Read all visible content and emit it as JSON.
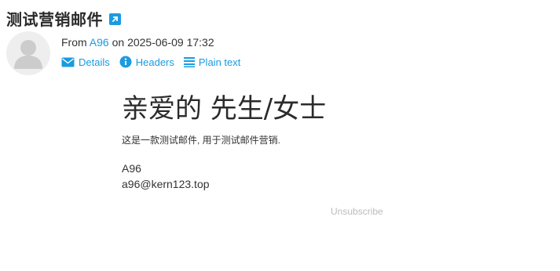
{
  "email": {
    "subject": "测试营销邮件",
    "from_prefix": "From",
    "sender_name": "A96",
    "date_prefix": "on",
    "date": "2025-06-09 17:32"
  },
  "actions": [
    {
      "label": "Details",
      "icon": "envelope-icon"
    },
    {
      "label": "Headers",
      "icon": "info-icon"
    },
    {
      "label": "Plain text",
      "icon": "lines-icon"
    }
  ],
  "content": {
    "greeting": "亲爱的 先生/女士",
    "intro": "这是一款测试邮件, 用于测试邮件营销.",
    "signature_name": "A96",
    "signature_email": "a96@kern123.top",
    "unsubscribe": "Unsubscribe"
  },
  "colors": {
    "link": "#1a9be0",
    "muted": "#bbbbbb"
  }
}
